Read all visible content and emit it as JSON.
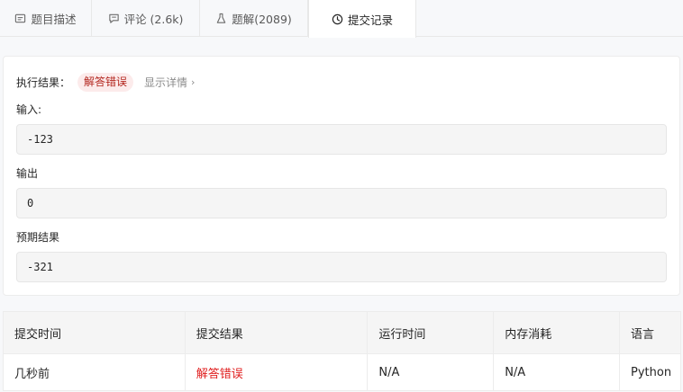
{
  "tabs": [
    {
      "label": "题目描述",
      "icon": "description-icon",
      "active": false
    },
    {
      "label": "评论 (2.6k)",
      "icon": "comment-icon",
      "active": false
    },
    {
      "label": "题解(2089)",
      "icon": "flask-icon",
      "active": false
    },
    {
      "label": "提交记录",
      "icon": "clock-icon",
      "active": true
    }
  ],
  "result": {
    "exec_label": "执行结果：",
    "status": "解答错误",
    "details_link": "显示详情",
    "input_label": "输入:",
    "input_value": "-123",
    "output_label": "输出",
    "output_value": "0",
    "expected_label": "预期结果",
    "expected_value": "-321"
  },
  "table": {
    "headers": [
      "提交时间",
      "提交结果",
      "运行时间",
      "内存消耗",
      "语言"
    ],
    "rows": [
      [
        "几秒前",
        "解答错误",
        "N/A",
        "N/A",
        "Python"
      ]
    ]
  },
  "colors": {
    "error": "#e02020",
    "badge_bg": "#fcebeb"
  }
}
